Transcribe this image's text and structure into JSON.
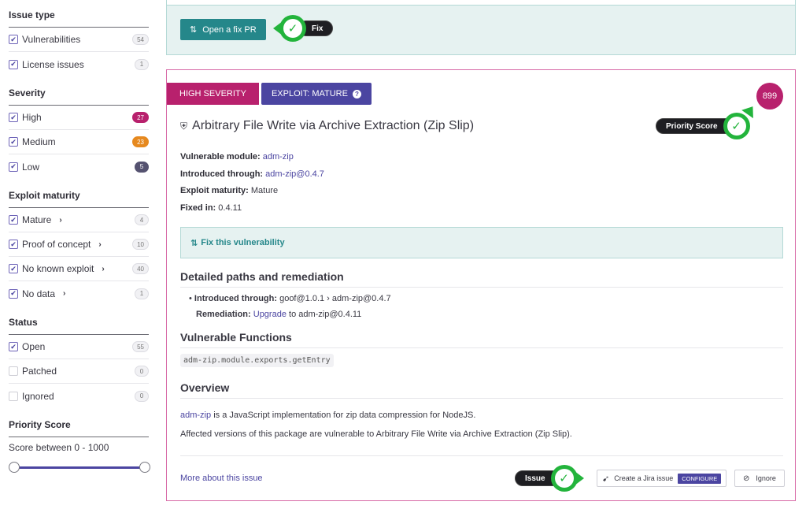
{
  "sidebar": {
    "issue_type": {
      "title": "Issue type",
      "items": [
        {
          "label": "Vulnerabilities",
          "count": "54",
          "checked": true
        },
        {
          "label": "License issues",
          "count": "1",
          "checked": true
        }
      ]
    },
    "severity": {
      "title": "Severity",
      "items": [
        {
          "label": "High",
          "count": "27",
          "checked": true
        },
        {
          "label": "Medium",
          "count": "23",
          "checked": true
        },
        {
          "label": "Low",
          "count": "5",
          "checked": true
        }
      ]
    },
    "exploit_maturity": {
      "title": "Exploit maturity",
      "items": [
        {
          "label": "Mature",
          "count": "4",
          "checked": true
        },
        {
          "label": "Proof of concept",
          "count": "10",
          "checked": true
        },
        {
          "label": "No known exploit",
          "count": "40",
          "checked": true
        },
        {
          "label": "No data",
          "count": "1",
          "checked": true
        }
      ]
    },
    "status": {
      "title": "Status",
      "items": [
        {
          "label": "Open",
          "count": "55",
          "checked": true
        },
        {
          "label": "Patched",
          "count": "0",
          "checked": false
        },
        {
          "label": "Ignored",
          "count": "0",
          "checked": false
        }
      ]
    },
    "priority_score": {
      "title": "Priority Score",
      "range_label": "Score between 0 - 1000",
      "min": 0,
      "max": 1000
    }
  },
  "fix_box": {
    "button_label": "Open a fix PR"
  },
  "callouts": {
    "fix": "Fix",
    "priority": "Priority Score",
    "issue": "Issue"
  },
  "issue": {
    "severity_tag": "HIGH SEVERITY",
    "exploit_tag": "EXPLOIT: MATURE",
    "priority_score": "899",
    "title": "Arbitrary File Write via Archive Extraction (Zip Slip)",
    "meta": {
      "module_label": "Vulnerable module:",
      "module_value": "adm-zip",
      "introduced_label": "Introduced through:",
      "introduced_value": "adm-zip@0.4.7",
      "exploit_label": "Exploit maturity:",
      "exploit_value": "Mature",
      "fixed_label": "Fixed in:",
      "fixed_value": "0.4.11"
    },
    "fix_vuln_label": "Fix this vulnerability",
    "paths_heading": "Detailed paths and remediation",
    "path_intro_label": "Introduced through:",
    "path_intro_value": "goof@1.0.1 › adm-zip@0.4.7",
    "remediation_label": "Remediation:",
    "remediation_link": "Upgrade",
    "remediation_rest": "to adm-zip@0.4.11",
    "functions_heading": "Vulnerable Functions",
    "function_code": "adm-zip.module.exports.getEntry",
    "overview_heading": "Overview",
    "overview_link": "adm-zip",
    "overview_line1_rest": "is a JavaScript implementation for zip data compression for NodeJS.",
    "overview_line2": "Affected versions of this package are vulnerable to Arbitrary File Write via Archive Extraction (Zip Slip).",
    "more_link": "More about this issue",
    "jira_label": "Create a Jira issue",
    "configure_label": "CONFIGURE",
    "ignore_label": "Ignore"
  }
}
